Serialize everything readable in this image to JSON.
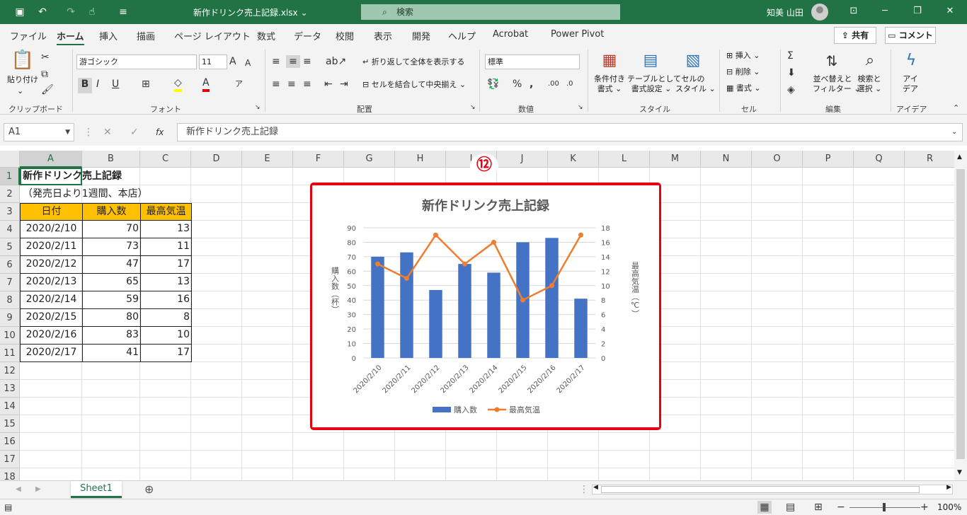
{
  "titlebar": {
    "title": "新作ドリンク売上記録.xlsx",
    "title_caret": "⌄",
    "search_placeholder": "検索",
    "user": "知美 山田"
  },
  "menu": {
    "items": [
      "ファイル",
      "ホーム",
      "挿入",
      "描画",
      "ページ レイアウト",
      "数式",
      "データ",
      "校閲",
      "表示",
      "開発",
      "ヘルプ",
      "Acrobat",
      "Power Pivot"
    ],
    "share": "共有",
    "comment": "コメント"
  },
  "ribbon": {
    "paste": "貼り付け",
    "font_name": "游ゴシック",
    "font_size": "11",
    "wrap_text": "折り返して全体を表示する",
    "merge_center": "セルを結合して中央揃え",
    "number_format": "標準",
    "cond_format_1": "条件付き",
    "cond_format_2": "書式",
    "table_format_1": "テーブルとして",
    "table_format_2": "書式設定",
    "cell_style_1": "セルの",
    "cell_style_2": "スタイル",
    "insert": "挿入",
    "delete": "削除",
    "format": "書式",
    "sort_1": "並べ替えと",
    "sort_2": "フィルター",
    "find_1": "検索と",
    "find_2": "選択",
    "ideas_1": "アイ",
    "ideas_2": "デア",
    "groups": [
      "クリップボード",
      "フォント",
      "配置",
      "数値",
      "スタイル",
      "セル",
      "編集",
      "アイデア"
    ]
  },
  "formula_bar": {
    "name_box": "A1",
    "formula": "新作ドリンク売上記録"
  },
  "sheet": {
    "columns": [
      "A",
      "B",
      "C",
      "D",
      "E",
      "F",
      "G",
      "H",
      "I",
      "J",
      "K",
      "L",
      "M",
      "N",
      "O",
      "P",
      "Q",
      "R"
    ],
    "rows": [
      "1",
      "2",
      "3",
      "4",
      "5",
      "6",
      "7",
      "8",
      "9",
      "10",
      "11",
      "12",
      "13",
      "14",
      "15",
      "16",
      "17",
      "18"
    ],
    "a1": "新作ドリンク売上記録",
    "a2": "（発売日より1週間、本店）",
    "headers": [
      "日付",
      "購入数",
      "最高気温"
    ],
    "data": [
      [
        "2020/2/10",
        "70",
        "13"
      ],
      [
        "2020/2/11",
        "73",
        "11"
      ],
      [
        "2020/2/12",
        "47",
        "17"
      ],
      [
        "2020/2/13",
        "65",
        "13"
      ],
      [
        "2020/2/14",
        "59",
        "16"
      ],
      [
        "2020/2/15",
        "80",
        "8"
      ],
      [
        "2020/2/16",
        "83",
        "10"
      ],
      [
        "2020/2/17",
        "41",
        "17"
      ]
    ],
    "header_color": "#FFC000"
  },
  "badge": "⑫",
  "chart_data": {
    "type": "bar",
    "title": "新作ドリンク売上記録",
    "categories": [
      "2020/2/10",
      "2020/2/11",
      "2020/2/12",
      "2020/2/13",
      "2020/2/14",
      "2020/2/15",
      "2020/2/16",
      "2020/2/17"
    ],
    "series": [
      {
        "name": "購入数",
        "type": "bar",
        "axis": "left",
        "color": "#4472C4",
        "values": [
          70,
          73,
          47,
          65,
          59,
          80,
          83,
          41
        ]
      },
      {
        "name": "最高気温",
        "type": "line",
        "axis": "right",
        "color": "#ED7D31",
        "values": [
          13,
          11,
          17,
          13,
          16,
          8,
          10,
          17
        ]
      }
    ],
    "ylabel": "購入数（杯）",
    "y2label": "最高気温（℃）",
    "ylim": [
      0,
      90
    ],
    "y2lim": [
      0,
      18
    ],
    "yticks": [
      "0",
      "10",
      "20",
      "30",
      "40",
      "50",
      "60",
      "70",
      "80",
      "90"
    ],
    "y2ticks": [
      "0",
      "2",
      "4",
      "6",
      "8",
      "10",
      "12",
      "14",
      "16",
      "18"
    ],
    "legend": "bottom",
    "grid": true
  },
  "tabs": {
    "sheet1": "Sheet1",
    "add": "⊕"
  },
  "status": {
    "zoom": "100%"
  }
}
